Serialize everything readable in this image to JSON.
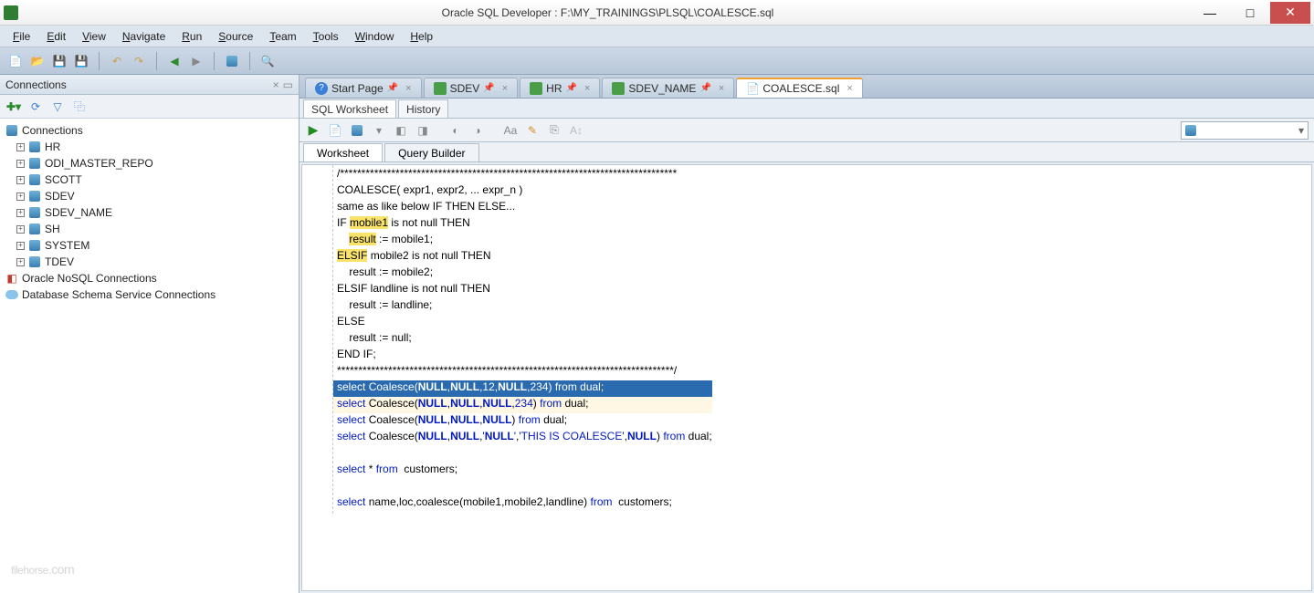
{
  "title": "Oracle SQL Developer : F:\\MY_TRAININGS\\PLSQL\\COALESCE.sql",
  "menu": [
    "File",
    "Edit",
    "View",
    "Navigate",
    "Run",
    "Source",
    "Team",
    "Tools",
    "Window",
    "Help"
  ],
  "sidebar": {
    "title": "Connections",
    "root": "Connections",
    "items": [
      "HR",
      "ODI_MASTER_REPO",
      "SCOTT",
      "SDEV",
      "SDEV_NAME",
      "SH",
      "SYSTEM",
      "TDEV"
    ],
    "extra": [
      "Oracle NoSQL Connections",
      "Database Schema Service Connections"
    ]
  },
  "tabs": [
    {
      "label": "Start Page",
      "icon": "help"
    },
    {
      "label": "SDEV",
      "icon": "sql"
    },
    {
      "label": "HR",
      "icon": "sql"
    },
    {
      "label": "SDEV_NAME",
      "icon": "sql"
    },
    {
      "label": "COALESCE.sql",
      "icon": "file",
      "active": true
    }
  ],
  "subtabs": [
    "SQL Worksheet",
    "History"
  ],
  "ws_tabs": [
    "Worksheet",
    "Query Builder"
  ],
  "code_lines": [
    {
      "t": "/*******************************************************************************",
      "cls": ""
    },
    {
      "t": "COALESCE( expr1, expr2, ... expr_n )",
      "cls": ""
    },
    {
      "t": "same as like below IF THEN ELSE...",
      "cls": ""
    },
    {
      "t": "IF mobile1 is not null THEN",
      "cls": "",
      "hl": {
        "start": 3,
        "end": 10
      }
    },
    {
      "t": "    result := mobile1;",
      "cls": "",
      "hl": {
        "start": 4,
        "end": 10
      }
    },
    {
      "t": "ELSIF mobile2 is not null THEN",
      "cls": "",
      "hl": {
        "start": 0,
        "end": 5
      }
    },
    {
      "t": "    result := mobile2;",
      "cls": ""
    },
    {
      "t": "ELSIF landline is not null THEN",
      "cls": ""
    },
    {
      "t": "    result := landline;",
      "cls": ""
    },
    {
      "t": "ELSE",
      "cls": ""
    },
    {
      "t": "    result := null;",
      "cls": ""
    },
    {
      "t": "END IF;",
      "cls": ""
    },
    {
      "t": "*******************************************************************************/",
      "cls": ""
    },
    {
      "t": "select Coalesce(NULL,NULL,12,NULL,234) from dual;",
      "cls": "selected"
    },
    {
      "t": "select Coalesce(NULL,NULL,NULL,234) from dual;",
      "cls": "cursor-row"
    },
    {
      "t": "select Coalesce(NULL,NULL,NULL) from dual;",
      "cls": ""
    },
    {
      "t": "select Coalesce(NULL,NULL,'NULL','THIS IS COALESCE',NULL) from dual;",
      "cls": ""
    },
    {
      "t": "",
      "cls": ""
    },
    {
      "t": "select * from  customers;",
      "cls": ""
    },
    {
      "t": "",
      "cls": ""
    },
    {
      "t": "select name,loc,coalesce(mobile1,mobile2,landline) from  customers;",
      "cls": ""
    }
  ],
  "watermark": {
    "main": "filehorse",
    "suffix": ".com"
  }
}
